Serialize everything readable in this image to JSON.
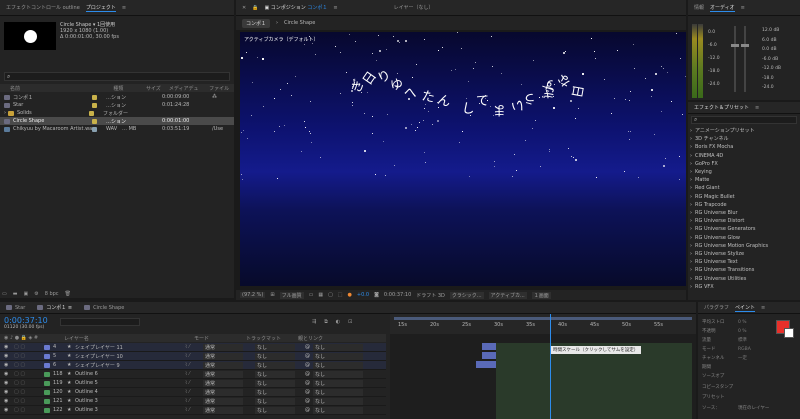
{
  "top": {
    "tab_effect_controls": "エフェクトコントロール outline",
    "tab_project": "プロジェクト",
    "tab_comp": "コンポジション",
    "tab_comp_name": "コンポ１",
    "tab_layer": "レイヤー（なし）",
    "tab_info": "情報",
    "tab_audio": "オーディオ",
    "tab_effects_presets": "エフェクト＆プリセット",
    "tab_paragraph": "パラグラフ",
    "tab_paint": "ペイント"
  },
  "project": {
    "item_name": "Circle Shape ▾ 1回使用",
    "item_dims": "1920 x 1080 (1.00)",
    "item_dur": "Δ 0:00:01:00, 30.00 fps",
    "columns": [
      "名前",
      "種類",
      "サイズ",
      "メディアデュ",
      "ファイル"
    ],
    "rows": [
      {
        "name": "コンポ１",
        "type": "…ション",
        "dur": "0:00:09:00",
        "path": ""
      },
      {
        "name": "Star",
        "type": "…ション",
        "dur": "0:01:24:28",
        "path": ""
      },
      {
        "name": "Solids",
        "type": "フォルダー",
        "dur": "",
        "path": ""
      },
      {
        "name": "Circle Shape",
        "type": "…ション",
        "dur": "0:00:01:00",
        "path": ""
      },
      {
        "name": "Chikyuu by Macaroom Artist.wav",
        "type": "WAV",
        "size": "… MB",
        "dur": "0:03:51:19",
        "path": "/Use"
      }
    ],
    "bpc": "8 bpc"
  },
  "viewer": {
    "breadcrumb_comp": "コンポ１",
    "breadcrumb_shape": "Circle Shape",
    "camera_label": "アクティブカメラ（デフォルト）",
    "zoom": "(97.2 %)",
    "quality": "フル画質",
    "exposure": "+0.0",
    "timecode": "0:00:37:10",
    "draft": "ドラフト 3D",
    "renderer": "クラシック...",
    "camera_sel": "アクティブカ...",
    "views": "１画面",
    "text_glyphs": [
      "ぎ",
      "日",
      "り",
      "ゆ",
      "へ",
      "た",
      "ん",
      "し",
      "て",
      "ま",
      "い",
      "う",
      "ぎ",
      "す",
      "な",
      "日"
    ]
  },
  "audio": {
    "db_left": [
      "0.0",
      "-6.0",
      "-12.0",
      "-18.0",
      "-24.0"
    ],
    "db_right": [
      "12.0 dB",
      "6.0 dB",
      "0.0 dB",
      "-6.0 dB",
      "-12.0 dB",
      "-18.0",
      "-24.0"
    ]
  },
  "effects": {
    "items": [
      "アニメーションプリセット",
      "3D チャンネル",
      "Boris FX Mocha",
      "CINEMA 4D",
      "GoPro FX",
      "Keying",
      "Matte",
      "Red Giant",
      "RG Magic Bullet",
      "RG Trapcode",
      "RG Universe Blur",
      "RG Universe Distort",
      "RG Universe Generators",
      "RG Universe Glow",
      "RG Universe Motion Graphics",
      "RG Universe Stylize",
      "RG Universe Text",
      "RG Universe Transitions",
      "RG Universe Utilities",
      "RG VFX"
    ]
  },
  "timeline": {
    "tabs": [
      "Star",
      "コンポ１",
      "Circle Shape"
    ],
    "timecode": "0:00:37:10",
    "frame_info": "01120 (30.00 fps)",
    "col_layer": "レイヤー名",
    "col_mode": "モード",
    "col_trkmat": "トラックマット",
    "col_parent": "親とリンク",
    "layers": [
      {
        "n": "4",
        "name": "シェイプレイヤー 11",
        "mode": "通常",
        "trk": "なし",
        "par": "なし"
      },
      {
        "n": "5",
        "name": "シェイプレイヤー 10",
        "mode": "通常",
        "trk": "なし",
        "par": "なし"
      },
      {
        "n": "6",
        "name": "シェイプレイヤー 9",
        "mode": "通常",
        "trk": "なし",
        "par": "なし"
      },
      {
        "n": "118",
        "name": "Outline 6",
        "mode": "通常",
        "trk": "なし",
        "par": "なし"
      },
      {
        "n": "119",
        "name": "Outline 5",
        "mode": "通常",
        "trk": "なし",
        "par": "なし"
      },
      {
        "n": "120",
        "name": "Outline 4",
        "mode": "通常",
        "trk": "なし",
        "par": "なし"
      },
      {
        "n": "121",
        "name": "Outline 3",
        "mode": "通常",
        "trk": "なし",
        "par": "なし"
      },
      {
        "n": "122",
        "name": "Outline 3",
        "mode": "通常",
        "trk": "なし",
        "par": "なし"
      }
    ],
    "ruler": [
      "15s",
      "20s",
      "25s",
      "30s",
      "35s",
      "40s",
      "45s",
      "50s",
      "55s"
    ],
    "tooltip": "時間スケール（クリックしてサムを設定）"
  },
  "right_bottom": {
    "paragraph_labels": [
      "平均ストロ",
      "不透明",
      "流量",
      "モード",
      "チャンネル",
      "期間",
      "ソースオプ"
    ],
    "values": [
      "0 %",
      "0 %",
      "標準",
      "RGBA",
      "一定"
    ],
    "duplicate_label": "ソース：",
    "preset_label": "プリセット",
    "source_label": "ソース：",
    "source_val": "現在のレイヤー",
    "clone_label": "コピースタンプ",
    "fore_color": "#e8302a"
  }
}
